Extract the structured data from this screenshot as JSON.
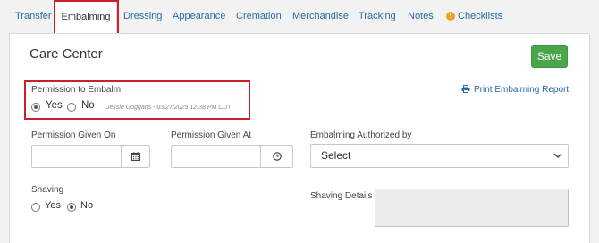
{
  "tabs": [
    {
      "label": "Transfer"
    },
    {
      "label": "Embalming",
      "active": true
    },
    {
      "label": "Dressing"
    },
    {
      "label": "Appearance"
    },
    {
      "label": "Cremation"
    },
    {
      "label": "Merchandise"
    },
    {
      "label": "Tracking"
    },
    {
      "label": "Notes"
    },
    {
      "label": "Checklists",
      "icon": "warning-icon"
    }
  ],
  "page": {
    "title": "Care Center",
    "save_label": "Save",
    "print_link": "Print Embalming Report"
  },
  "permission_to_embalm": {
    "label": "Permission to Embalm",
    "yes_label": "Yes",
    "no_label": "No",
    "selected": "Yes",
    "audit_text": "Jessie Goggans - 03/27/2025 12:38 PM CDT"
  },
  "permission_given_on": {
    "label": "Permission Given On",
    "value": ""
  },
  "permission_given_at": {
    "label": "Permission Given At",
    "value": ""
  },
  "embalming_authorized_by": {
    "label": "Embalming Authorized by",
    "value": "Select"
  },
  "shaving": {
    "label": "Shaving",
    "yes_label": "Yes",
    "no_label": "No",
    "selected": "No"
  },
  "shaving_details": {
    "label": "Shaving Details",
    "value": ""
  },
  "colors": {
    "link": "#2a6aa8",
    "save": "#4aa64a",
    "highlight": "#cc1f2d",
    "warning": "#f0a020"
  }
}
